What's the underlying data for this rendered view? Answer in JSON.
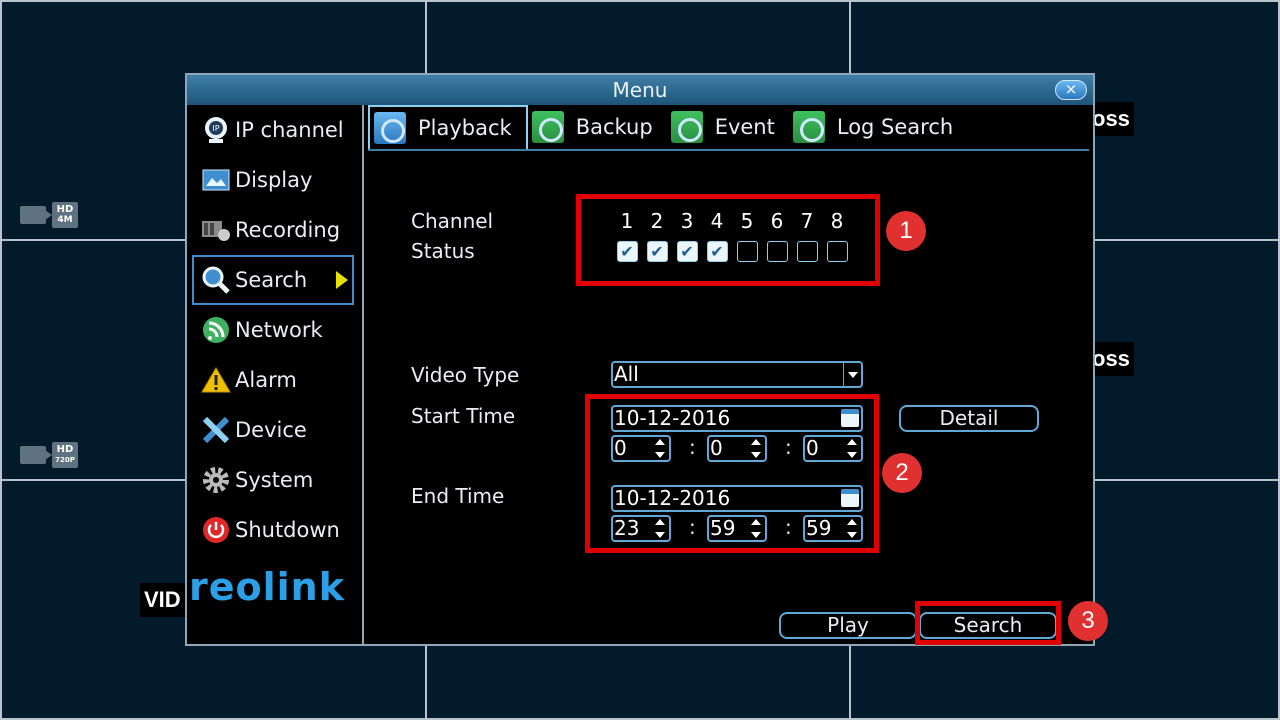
{
  "background": {
    "badges": [
      {
        "hd": "HD",
        "res": "4M"
      },
      {
        "hd": "HD",
        "res": "720P"
      }
    ],
    "overlay_texts": [
      "oss",
      "oss",
      "VID"
    ]
  },
  "menu": {
    "title": "Menu",
    "close_label": "×"
  },
  "sidebar": {
    "items": [
      {
        "label": "IP channel",
        "icon": "ip-camera-icon"
      },
      {
        "label": "Display",
        "icon": "display-icon"
      },
      {
        "label": "Recording",
        "icon": "recording-icon"
      },
      {
        "label": "Search",
        "icon": "search-icon",
        "active": true
      },
      {
        "label": "Network",
        "icon": "network-icon"
      },
      {
        "label": "Alarm",
        "icon": "alarm-icon"
      },
      {
        "label": "Device",
        "icon": "device-icon"
      },
      {
        "label": "System",
        "icon": "system-icon"
      },
      {
        "label": "Shutdown",
        "icon": "shutdown-icon"
      }
    ],
    "logo": "reolink"
  },
  "tabs": [
    {
      "label": "Playback",
      "active": true
    },
    {
      "label": "Backup"
    },
    {
      "label": "Event"
    },
    {
      "label": "Log Search"
    }
  ],
  "form": {
    "channel_label": "Channel",
    "status_label": "Status",
    "channels": [
      {
        "num": "1",
        "checked": true
      },
      {
        "num": "2",
        "checked": true
      },
      {
        "num": "3",
        "checked": true
      },
      {
        "num": "4",
        "checked": true
      },
      {
        "num": "5",
        "checked": false
      },
      {
        "num": "6",
        "checked": false
      },
      {
        "num": "7",
        "checked": false
      },
      {
        "num": "8",
        "checked": false
      }
    ],
    "video_type_label": "Video Type",
    "video_type_value": "All",
    "start_time_label": "Start Time",
    "start_date": "10-12-2016",
    "start_h": "0",
    "start_m": "0",
    "start_s": "0",
    "end_time_label": "End Time",
    "end_date": "10-12-2016",
    "end_h": "23",
    "end_m": "59",
    "end_s": "59",
    "colon": ":",
    "detail_label": "Detail",
    "play_label": "Play",
    "search_label": "Search"
  },
  "annotations": [
    "1",
    "2",
    "3"
  ],
  "colors": {
    "annotation_red": "#e00000",
    "accent_blue": "#3f8fd0",
    "title_bar": "#2a6a92"
  }
}
